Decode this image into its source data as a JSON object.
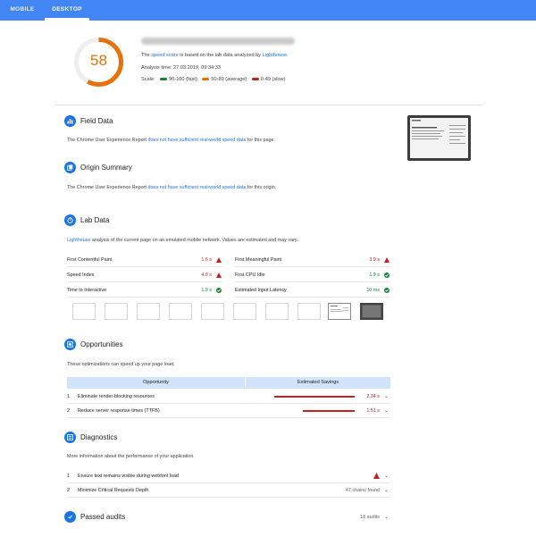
{
  "tabs": {
    "mobile": "MOBILE",
    "desktop": "DESKTOP"
  },
  "summary": {
    "score": "58",
    "score_fraction": 0.58,
    "line1_pre": "The",
    "line1_link1": "speed score",
    "line1_mid": "is based on the lab data analyzed by",
    "line1_link2": "Lighthouse",
    "line1_end": ".",
    "analysis_time": "Analysis time: 27.03.2019, 09:34:33",
    "scale_label": "Scale:",
    "scale_fast": "90-100 (fast)",
    "scale_average": "50-89 (average)",
    "scale_slow": "0-49 (slow)"
  },
  "colors": {
    "accent": "#1a73e8",
    "bar": "#4285f4",
    "fast": "#188038",
    "average": "#e8710a",
    "slow": "#c5221f"
  },
  "field_data": {
    "title": "Field Data",
    "text_pre": "The Chrome User Experience Report",
    "text_link": "does not have sufficient real-world speed data",
    "text_post": "for this page."
  },
  "origin_summary": {
    "title": "Origin Summary",
    "text_pre": "The Chrome User Experience Report",
    "text_link": "does not have sufficient real-world speed data",
    "text_post": "for this origin."
  },
  "lab_data": {
    "title": "Lab Data",
    "text_link": "Lighthouse",
    "text_post": "analysis of the current page on an emulated mobile network. Values are estimated and may vary.",
    "metrics": [
      {
        "label": "First Contentful Paint",
        "value": "1.6 s",
        "status": "slow",
        "icon": "warning-icon"
      },
      {
        "label": "First Meaningful Paint",
        "value": "3.9 s",
        "status": "slow",
        "icon": "warning-icon"
      },
      {
        "label": "Speed Index",
        "value": "4.0 s",
        "status": "slow",
        "icon": "warning-icon"
      },
      {
        "label": "First CPU Idle",
        "value": "1.9 s",
        "status": "fast",
        "icon": "check-icon"
      },
      {
        "label": "Time to Interactive",
        "value": "1.9 s",
        "status": "fast",
        "icon": "check-icon"
      },
      {
        "label": "Estimated Input Latency",
        "value": "10 ms",
        "status": "fast",
        "icon": "check-icon"
      }
    ]
  },
  "opportunities": {
    "title": "Opportunities",
    "text": "These optimizations can speed up your page load.",
    "col_opportunity": "Opportunity",
    "col_savings": "Estimated Savings",
    "rows": [
      {
        "num": "1",
        "label": "Eliminate render-blocking resources",
        "value": "2.34 s",
        "savings_fraction": 1.0
      },
      {
        "num": "2",
        "label": "Reduce server response times (TTFB)",
        "value": "1.51 s",
        "savings_fraction": 0.65
      }
    ]
  },
  "diagnostics": {
    "title": "Diagnostics",
    "text": "More information about the performance of your application.",
    "rows": [
      {
        "num": "1",
        "label": "Ensure text remains visible during webfont load",
        "value": ""
      },
      {
        "num": "2",
        "label": "Minimize Critical Requests Depth",
        "value": "47 chains found"
      }
    ]
  },
  "passed_audits": {
    "title": "Passed audits",
    "value": "18 audits"
  }
}
